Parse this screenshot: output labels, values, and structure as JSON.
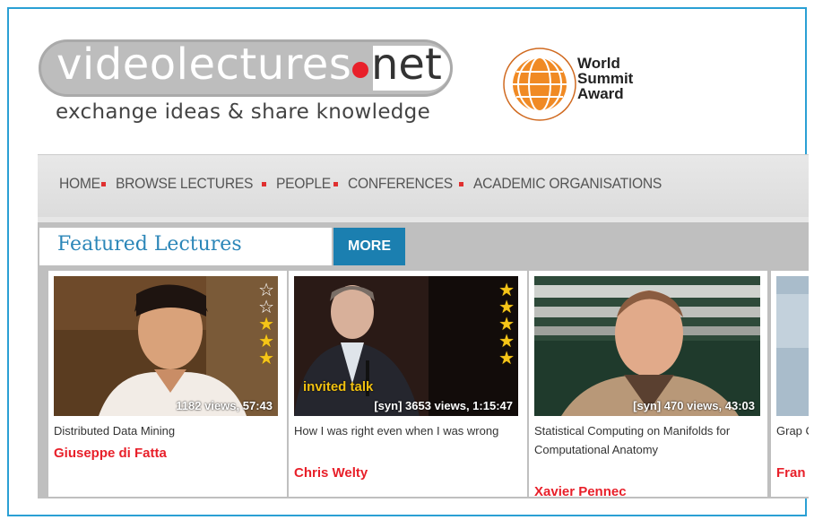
{
  "logo": {
    "brand_word": "videolectures",
    "brand_tld": "net",
    "tagline": "exchange ideas & share knowledge"
  },
  "award": {
    "line1": "World",
    "line2": "Summit",
    "line3": "Award",
    "icon": "globe-icon"
  },
  "nav": {
    "items": [
      "HOME",
      "BROWSE LECTURES",
      "PEOPLE",
      "CONFERENCES",
      "ACADEMIC ORGANISATIONS"
    ]
  },
  "featured": {
    "title": "Featured Lectures",
    "more_label": "MORE"
  },
  "lectures": [
    {
      "title": "Distributed Data Mining",
      "author": "Giuseppe di Fatta",
      "views": "1182 views, 57:43",
      "rating": 3,
      "badge": ""
    },
    {
      "title": "How I was right even when I was wrong",
      "author": "Chris Welty",
      "views": "[syn] 3653 views, 1:15:47",
      "rating": 5,
      "badge": "invited talk"
    },
    {
      "title": "Statistical Computing on Manifolds for Computational Anatomy",
      "author": "Xavier Pennec",
      "views": "[syn] 470 views, 43:03",
      "rating": 0,
      "badge": ""
    },
    {
      "title": "Grap Clou",
      "author": "Fran",
      "views": "",
      "rating": 0,
      "badge": ""
    }
  ],
  "colors": {
    "accent_blue": "#2b86b8",
    "more_button": "#1b7fb0",
    "author_red": "#e8202a",
    "star_gold": "#f5c518"
  }
}
